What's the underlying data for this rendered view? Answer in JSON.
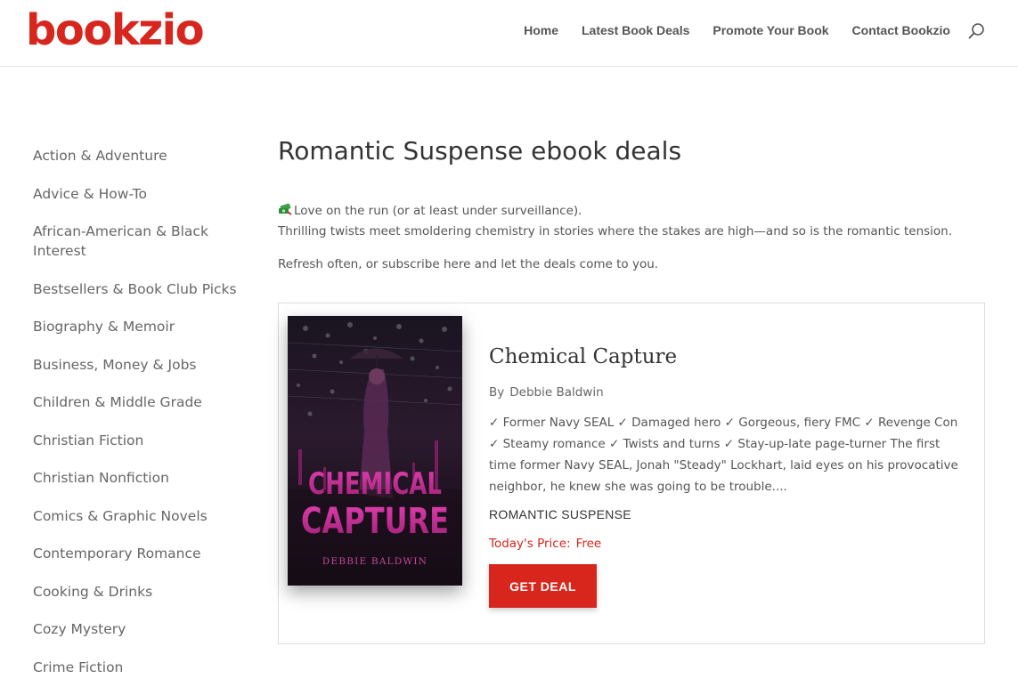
{
  "header": {
    "logo_text": "bookzio",
    "nav": [
      "Home",
      "Latest Book Deals",
      "Promote Your Book",
      "Contact Bookzio"
    ],
    "search_icon": "search-icon"
  },
  "sidebar": {
    "items": [
      "Action & Adventure",
      "Advice & How-To",
      "African-American & Black Interest",
      "Bestsellers & Book Club Picks",
      "Biography & Memoir",
      "Business, Money & Jobs",
      "Children & Middle Grade",
      "Christian Fiction",
      "Christian Nonfiction",
      "Comics & Graphic Novels",
      "Contemporary Romance",
      "Cooking & Drinks",
      "Cozy Mystery",
      "Crime Fiction"
    ]
  },
  "main": {
    "title": "Romantic Suspense ebook deals",
    "intro_line1": "Love on the run (or at least under surveillance).",
    "intro_line2": "Thrilling twists meet smoldering chemistry in stories where the stakes are high—and so is the romantic tension.",
    "refresh": "Refresh often, or subscribe here and let the deals come to you."
  },
  "book": {
    "title": "Chemical Capture",
    "by_label": "By",
    "author": "Debbie Baldwin",
    "description": "✓ Former Navy SEAL ✓ Damaged hero ✓ Gorgeous, fiery FMC ✓ Revenge Con ✓ Steamy romance ✓ Twists and turns ✓ Stay-up-late page-turner The first time former Navy SEAL, Jonah \"Steady\" Lockhart, laid eyes on his provocative neighbor, he knew she was going to be trouble....",
    "genre": "ROMANTIC SUSPENSE",
    "price_label": "Today's Price:",
    "price_value": "Free",
    "button_label": "GET DEAL",
    "cover": {
      "title_line1": "CHEMICAL",
      "title_line2": "CAPTURE",
      "author": "DEBBIE BALDWIN"
    }
  },
  "colors": {
    "brand_red": "#d7261e",
    "cover_magenta": "#c7268f"
  }
}
